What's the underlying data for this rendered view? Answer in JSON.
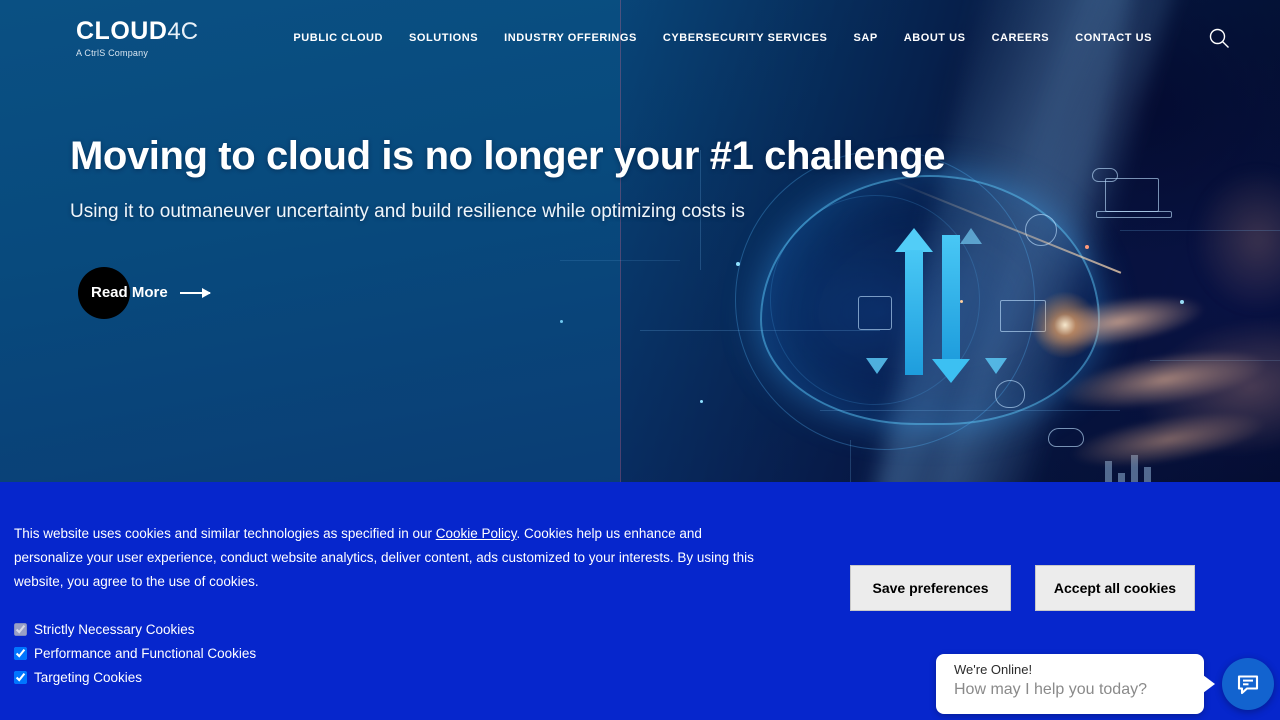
{
  "header": {
    "logo": {
      "primary": "CLOUD",
      "secondary": "4C",
      "tagline": "A CtrlS Company"
    },
    "nav": [
      {
        "label": "PUBLIC CLOUD"
      },
      {
        "label": "SOLUTIONS"
      },
      {
        "label": "INDUSTRY OFFERINGS"
      },
      {
        "label": "CYBERSECURITY SERVICES"
      },
      {
        "label": "SAP"
      },
      {
        "label": "ABOUT US"
      },
      {
        "label": "CAREERS"
      },
      {
        "label": "CONTACT US"
      }
    ],
    "search_icon": "search-icon"
  },
  "hero": {
    "title": "Moving to cloud is no longer your #1 challenge",
    "subtitle": "Using it to outmaneuver uncertainty and build resilience while optimizing costs is",
    "cta_label": "Read More",
    "cta_icon": "arrow-right-icon",
    "background_color": "#0a4a7e"
  },
  "cookie_banner": {
    "background_color": "#0626cc",
    "text_part1": "This website uses cookies and similar technologies as specified in our ",
    "policy_link": "Cookie Policy",
    "text_part2": ". Cookies help us enhance and personalize your user experience, conduct website analytics, deliver content, ads customized to your interests. By using this website, you agree to the use of cookies.",
    "options": [
      {
        "label": "Strictly Necessary Cookies",
        "checked": true,
        "disabled": true
      },
      {
        "label": "Performance and Functional Cookies",
        "checked": true,
        "disabled": false
      },
      {
        "label": "Targeting Cookies",
        "checked": true,
        "disabled": false
      }
    ],
    "save_label": "Save preferences",
    "accept_label": "Accept all cookies"
  },
  "chat_widget": {
    "status": "We're Online!",
    "prompt": "How may I help you today?",
    "icon": "chat-bubble-icon",
    "button_color": "#1263cf"
  }
}
